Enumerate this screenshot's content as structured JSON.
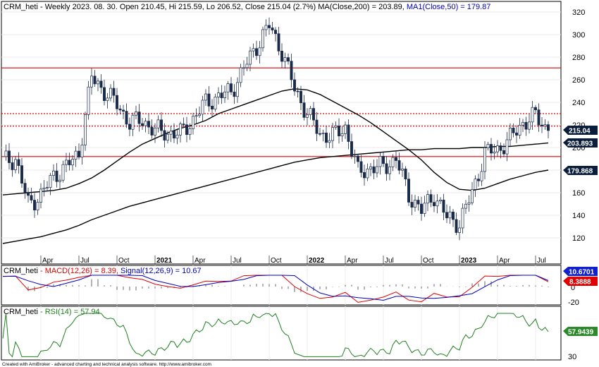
{
  "credit": "Created with AmiBroker - advanced charting and technical analysis software. http://www.amibroker.com",
  "colors": {
    "frame": "#000000",
    "resistance": "#e00000",
    "ma": "#000000",
    "macd": "#e00000",
    "signal": "#0000c0",
    "rsi": "#208020",
    "badge_price": "#0a1e3c",
    "badge_signal": "#1020d0",
    "badge_macd": "#e00000",
    "badge_rsi": "#2a8a2a"
  },
  "price_panel": {
    "ticker": "CRM_heti",
    "info": "- Weekly 2023. 08. 30. Open 210.45, Hi 215.59, Lo 206.52, Close 215.04 (2.7%)",
    "ma200_text": "MA(Close,200) = 203.89,",
    "ma50_text": "MA1(Close,50) = 179.87",
    "y_ticks": [
      "320",
      "300",
      "280",
      "260",
      "240",
      "220",
      "200",
      "180",
      "160",
      "140",
      "120"
    ],
    "badges": {
      "close": "215.04",
      "ma200": "203.893",
      "ma50": "179.868"
    }
  },
  "x_axis": {
    "labels": [
      "Apr",
      "Jul",
      "Oct",
      "2021",
      "Apr",
      "Jul",
      "Oct",
      "2022",
      "Apr",
      "Jul",
      "Oct",
      "2023",
      "Apr",
      "Jul"
    ],
    "bold": [
      false,
      false,
      false,
      true,
      false,
      false,
      false,
      true,
      false,
      false,
      false,
      true,
      false,
      false
    ]
  },
  "macd_panel": {
    "ticker": "CRM_heti",
    "macd_text": "- MACD(12,26) = 8.39,",
    "signal_text": "Signal(12,26,9) = 10.67",
    "y_ticks": [
      "0",
      "-20"
    ],
    "badges": {
      "signal": "10.6701",
      "macd": "8.3888"
    }
  },
  "rsi_panel": {
    "ticker": "CRM_heti",
    "rsi_text": "- RSI(14) = 57.94",
    "y_ticks": [
      "30"
    ],
    "badges": {
      "rsi": "57.9439"
    }
  },
  "chart_data": {
    "type": "candlestick",
    "title": "CRM_heti - Weekly 2023. 08. 30. Open 210.45, Hi 215.59, Lo 206.52, Close 215.04 (2.7%)",
    "timeframe": "weekly",
    "x_range": [
      "2020-01",
      "2023-08"
    ],
    "ylim": [
      110,
      328
    ],
    "ohlc_last": {
      "open": 210.45,
      "high": 215.59,
      "low": 206.52,
      "close": 215.04,
      "change_pct": 2.7
    },
    "horizontal_lines": [
      {
        "value": 270.5,
        "style": "solid"
      },
      {
        "value": 230,
        "style": "dotted"
      },
      {
        "value": 219,
        "style": "dotted"
      },
      {
        "value": 192,
        "style": "solid"
      }
    ],
    "close_series": {
      "dates": [
        "2020-01",
        "2020-02",
        "2020-03",
        "2020-04",
        "2020-05",
        "2020-06",
        "2020-07",
        "2020-08",
        "2020-09",
        "2020-10",
        "2020-11",
        "2020-12",
        "2021-01",
        "2021-02",
        "2021-03",
        "2021-04",
        "2021-05",
        "2021-06",
        "2021-07",
        "2021-08",
        "2021-09",
        "2021-10",
        "2021-11",
        "2021-12",
        "2022-01",
        "2022-02",
        "2022-03",
        "2022-04",
        "2022-05",
        "2022-06",
        "2022-07",
        "2022-08",
        "2022-09",
        "2022-10",
        "2022-11",
        "2022-12",
        "2023-01",
        "2023-02",
        "2023-03",
        "2023-04",
        "2023-05",
        "2023-06",
        "2023-07",
        "2023-08"
      ],
      "close": [
        188,
        190,
        150,
        158,
        175,
        183,
        195,
        262,
        250,
        238,
        222,
        224,
        215,
        213,
        212,
        225,
        240,
        245,
        250,
        270,
        290,
        308,
        285,
        252,
        230,
        212,
        210,
        218,
        178,
        182,
        183,
        190,
        158,
        144,
        158,
        138,
        133,
        160,
        195,
        198,
        208,
        222,
        228,
        215
      ]
    },
    "ma200_series": [
      115,
      117,
      119,
      121,
      124,
      127,
      131,
      136,
      140,
      144,
      148,
      151,
      154,
      157,
      160,
      163,
      166,
      169,
      172,
      175,
      178,
      181,
      184,
      187,
      189,
      191,
      192,
      193,
      194,
      195,
      196,
      197,
      198,
      198,
      199,
      199,
      199,
      200,
      200,
      201,
      201,
      202,
      203,
      204
    ],
    "ma50_series": [
      158,
      159,
      160,
      161,
      162,
      164,
      168,
      173,
      180,
      188,
      196,
      203,
      208,
      213,
      217,
      220,
      224,
      230,
      234,
      238,
      242,
      246,
      250,
      252,
      251,
      247,
      241,
      235,
      229,
      222,
      214,
      206,
      198,
      189,
      178,
      169,
      163,
      162,
      164,
      168,
      172,
      175,
      178,
      180
    ],
    "macd": {
      "last_macd": 8.39,
      "last_signal": 10.67,
      "ylim": [
        -28,
        20
      ]
    },
    "rsi": {
      "last": 57.94,
      "ylim": [
        25,
        80
      ]
    }
  }
}
